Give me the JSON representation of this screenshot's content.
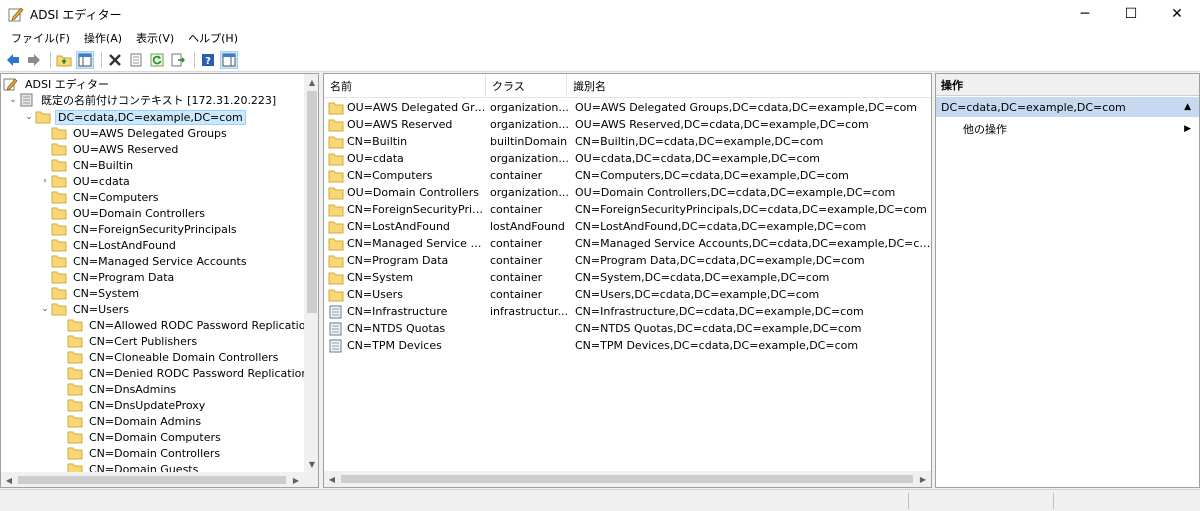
{
  "window": {
    "title": "ADSI エディター",
    "minimize": "─",
    "maximize": "☐",
    "close": "✕"
  },
  "menu": [
    "ファイル(F)",
    "操作(A)",
    "表示(V)",
    "ヘルプ(H)"
  ],
  "toolbar": {
    "icons": [
      "back-arrow-icon",
      "forward-arrow-icon",
      "up-folder-icon",
      "show-hide-tree-icon",
      "delete-icon",
      "properties-icon",
      "refresh-icon",
      "export-list-icon",
      "help-icon",
      "show-hide-action-pane-icon"
    ]
  },
  "tree": {
    "root": "ADSI エディター",
    "context": "既定の名前付けコンテキスト [172.31.20.223]",
    "selected": "DC=cdata,DC=example,DC=com",
    "children": [
      {
        "label": "OU=AWS Delegated Groups",
        "expandable": false
      },
      {
        "label": "OU=AWS Reserved",
        "expandable": false
      },
      {
        "label": "CN=Builtin",
        "expandable": false
      },
      {
        "label": "OU=cdata",
        "expandable": true
      },
      {
        "label": "CN=Computers",
        "expandable": false
      },
      {
        "label": "OU=Domain Controllers",
        "expandable": false
      },
      {
        "label": "CN=ForeignSecurityPrincipals",
        "expandable": false
      },
      {
        "label": "CN=LostAndFound",
        "expandable": false
      },
      {
        "label": "CN=Managed Service Accounts",
        "expandable": false
      },
      {
        "label": "CN=Program Data",
        "expandable": false
      },
      {
        "label": "CN=System",
        "expandable": false
      },
      {
        "label": "CN=Users",
        "expandable": "open"
      }
    ],
    "users_children": [
      "CN=Allowed RODC Password Replication Gro",
      "CN=Cert Publishers",
      "CN=Cloneable Domain Controllers",
      "CN=Denied RODC Password Replication Grou",
      "CN=DnsAdmins",
      "CN=DnsUpdateProxy",
      "CN=Domain Admins",
      "CN=Domain Computers",
      "CN=Domain Controllers",
      "CN=Domain Guests"
    ]
  },
  "list": {
    "columns": [
      "名前",
      "クラス",
      "識別名"
    ],
    "rows": [
      {
        "name": "OU=AWS Delegated Groups",
        "class": "organization...",
        "dn": "OU=AWS Delegated Groups,DC=cdata,DC=example,DC=com",
        "icon": "folder"
      },
      {
        "name": "OU=AWS Reserved",
        "class": "organization...",
        "dn": "OU=AWS Reserved,DC=cdata,DC=example,DC=com",
        "icon": "folder"
      },
      {
        "name": "CN=Builtin",
        "class": "builtinDomain",
        "dn": "CN=Builtin,DC=cdata,DC=example,DC=com",
        "icon": "folder"
      },
      {
        "name": "OU=cdata",
        "class": "organization...",
        "dn": "OU=cdata,DC=cdata,DC=example,DC=com",
        "icon": "folder"
      },
      {
        "name": "CN=Computers",
        "class": "container",
        "dn": "CN=Computers,DC=cdata,DC=example,DC=com",
        "icon": "folder"
      },
      {
        "name": "OU=Domain Controllers",
        "class": "organization...",
        "dn": "OU=Domain Controllers,DC=cdata,DC=example,DC=com",
        "icon": "folder"
      },
      {
        "name": "CN=ForeignSecurityPrincip...",
        "class": "container",
        "dn": "CN=ForeignSecurityPrincipals,DC=cdata,DC=example,DC=com",
        "icon": "folder"
      },
      {
        "name": "CN=LostAndFound",
        "class": "lostAndFound",
        "dn": "CN=LostAndFound,DC=cdata,DC=example,DC=com",
        "icon": "folder"
      },
      {
        "name": "CN=Managed Service Acco...",
        "class": "container",
        "dn": "CN=Managed Service Accounts,DC=cdata,DC=example,DC=com",
        "icon": "folder"
      },
      {
        "name": "CN=Program Data",
        "class": "container",
        "dn": "CN=Program Data,DC=cdata,DC=example,DC=com",
        "icon": "folder"
      },
      {
        "name": "CN=System",
        "class": "container",
        "dn": "CN=System,DC=cdata,DC=example,DC=com",
        "icon": "folder"
      },
      {
        "name": "CN=Users",
        "class": "container",
        "dn": "CN=Users,DC=cdata,DC=example,DC=com",
        "icon": "folder"
      },
      {
        "name": "CN=Infrastructure",
        "class": "infrastructur...",
        "dn": "CN=Infrastructure,DC=cdata,DC=example,DC=com",
        "icon": "object"
      },
      {
        "name": "CN=NTDS Quotas",
        "class": "",
        "dn": "CN=NTDS Quotas,DC=cdata,DC=example,DC=com",
        "icon": "object"
      },
      {
        "name": "CN=TPM Devices",
        "class": "",
        "dn": "CN=TPM Devices,DC=cdata,DC=example,DC=com",
        "icon": "object"
      }
    ]
  },
  "actions": {
    "header": "操作",
    "section": "DC=cdata,DC=example,DC=com",
    "more": "他の操作"
  },
  "colors": {
    "selection_bg": "#cce8ff",
    "action_section_bg": "#c7d9f0",
    "folder_yellow": "#f8d775"
  }
}
